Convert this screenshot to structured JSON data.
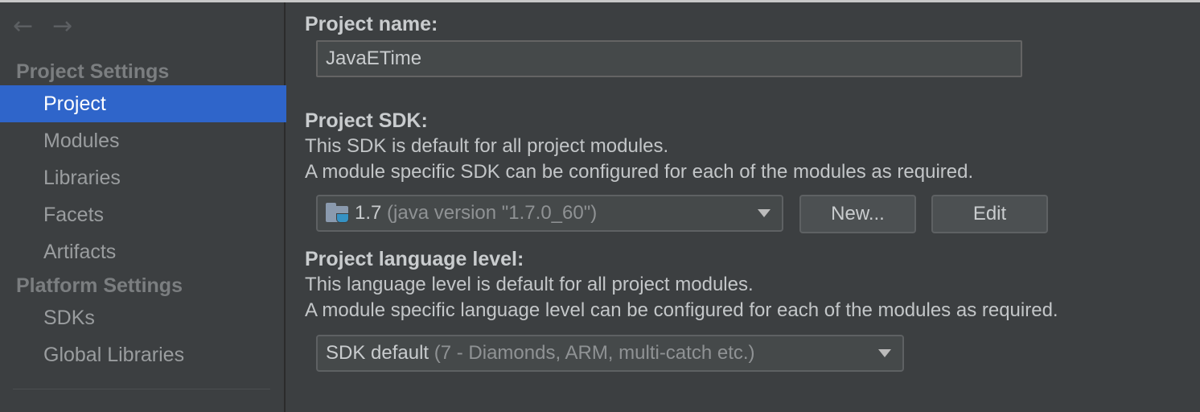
{
  "nav": {
    "back_glyph": "←",
    "forward_glyph": "→"
  },
  "sidebar": {
    "sections": [
      {
        "title": "Project Settings",
        "items": [
          {
            "label": "Project",
            "selected": true
          },
          {
            "label": "Modules",
            "selected": false
          },
          {
            "label": "Libraries",
            "selected": false
          },
          {
            "label": "Facets",
            "selected": false
          },
          {
            "label": "Artifacts",
            "selected": false
          }
        ]
      },
      {
        "title": "Platform Settings",
        "items": [
          {
            "label": "SDKs",
            "selected": false
          },
          {
            "label": "Global Libraries",
            "selected": false
          }
        ]
      }
    ]
  },
  "main": {
    "project_name": {
      "label": "Project name:",
      "value": "JavaETime"
    },
    "project_sdk": {
      "label": "Project SDK:",
      "description_line1": "This SDK is default for all project modules.",
      "description_line2": "A module specific SDK can be configured for each of the modules as required.",
      "selected_version": "1.7",
      "selected_detail": "(java version \"1.7.0_60\")",
      "icon": "jdk-folder-icon",
      "new_button": "New...",
      "edit_button": "Edit"
    },
    "language_level": {
      "label": "Project language level:",
      "description_line1": "This language level is default for all project modules.",
      "description_line2": "A module specific language level can be configured for each of the modules as required.",
      "selected_value": "SDK default",
      "selected_detail": "(7 - Diamonds, ARM, multi-catch etc.)"
    }
  },
  "colors": {
    "background": "#3c3f41",
    "selection": "#2f65ca",
    "text": "#c9ccce",
    "muted_text": "#9a9d9f",
    "section_header": "#7b7e80"
  }
}
